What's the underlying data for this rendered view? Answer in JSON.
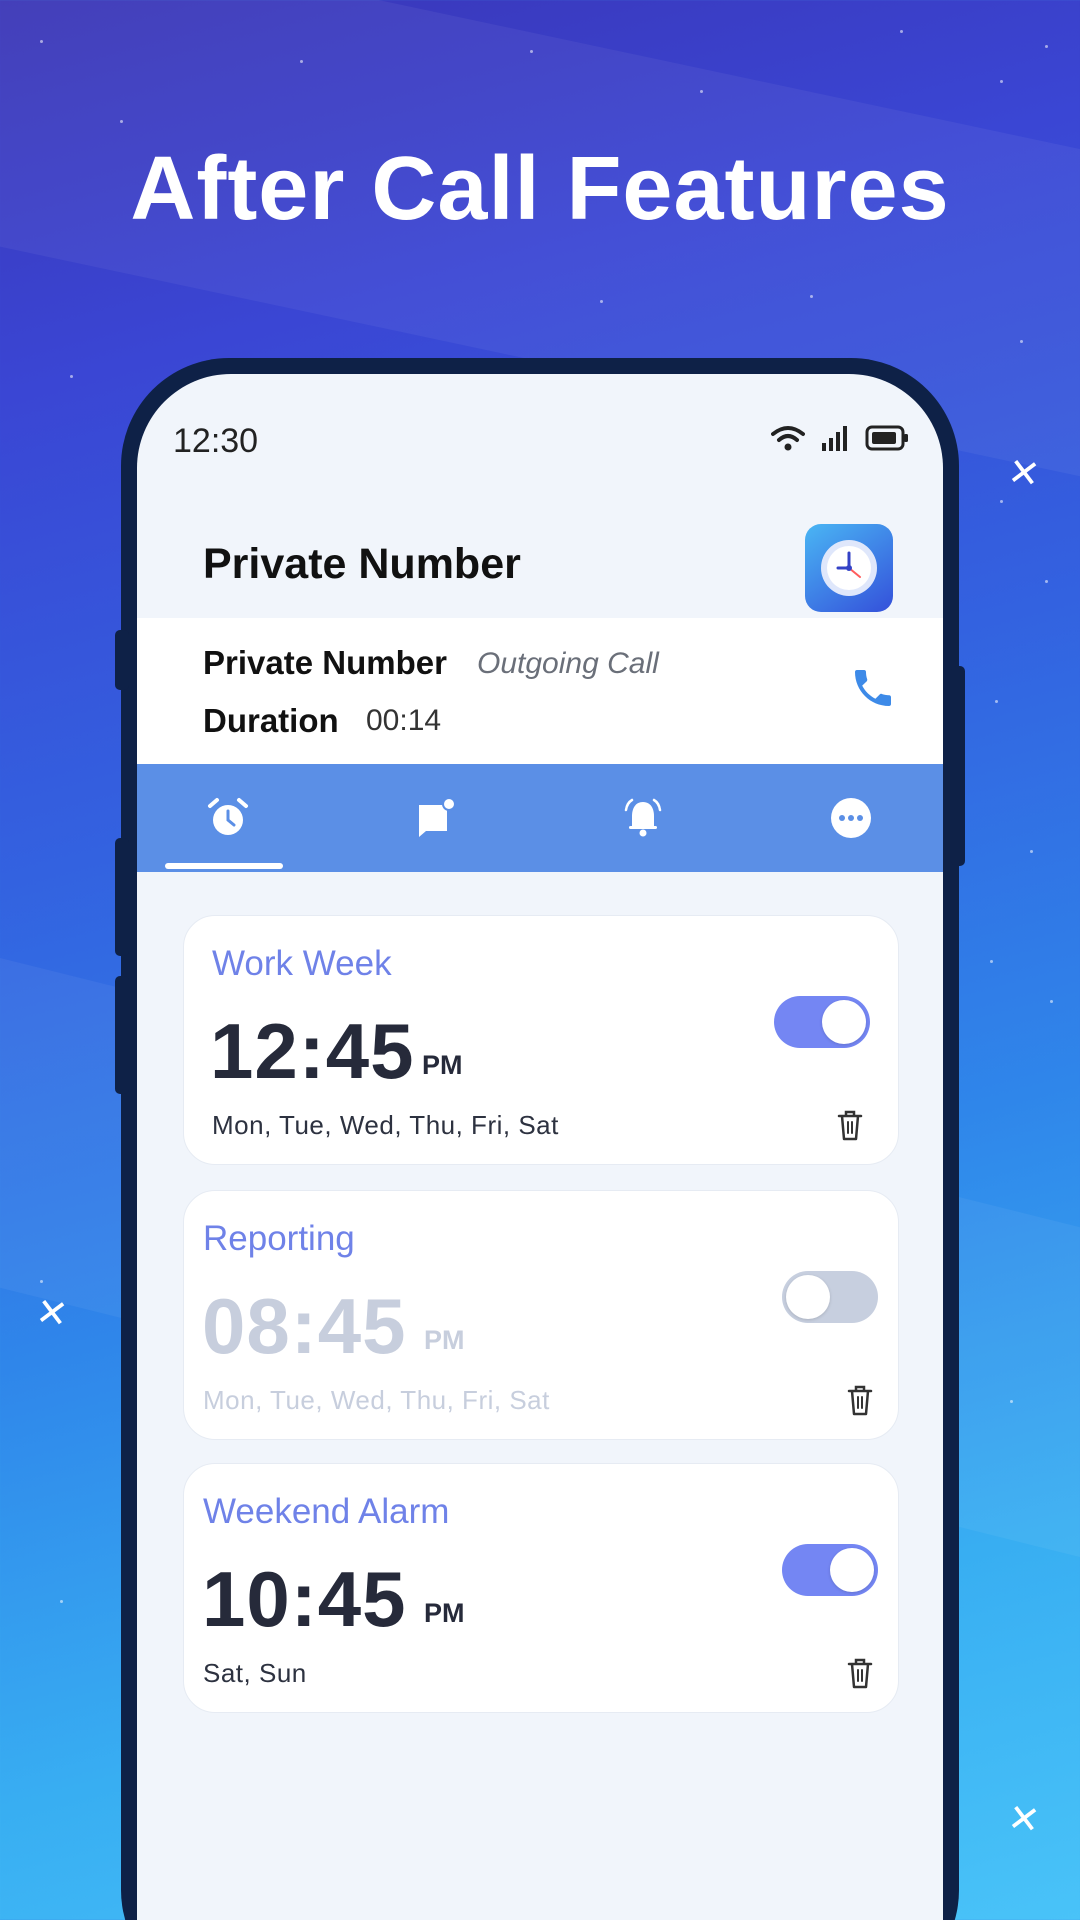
{
  "headline": "After Call Features",
  "status_bar": {
    "time": "12:30",
    "icons": [
      "wifi-icon",
      "signal-icon",
      "battery-icon"
    ]
  },
  "call_header": {
    "title": "Private Number",
    "app_icon": "clock-icon"
  },
  "call_info": {
    "name": "Private Number",
    "type": "Outgoing Call",
    "duration_label": "Duration",
    "duration": "00:14",
    "action_icon": "phone-icon"
  },
  "tabs": [
    {
      "icon": "alarm-clock-icon",
      "selected": true
    },
    {
      "icon": "message-icon",
      "selected": false
    },
    {
      "icon": "bell-icon",
      "selected": false
    },
    {
      "icon": "more-icon",
      "selected": false
    }
  ],
  "alarms": [
    {
      "label": "Work Week",
      "time": "12:45",
      "ampm": "PM",
      "days": "Mon, Tue, Wed, Thu, Fri, Sat",
      "enabled": true
    },
    {
      "label": "Reporting",
      "time": "08:45",
      "ampm": "PM",
      "days": "Mon, Tue, Wed, Thu, Fri, Sat",
      "enabled": false
    },
    {
      "label": "Weekend Alarm",
      "time": "10:45",
      "ampm": "PM",
      "days": "Sat, Sun",
      "enabled": true
    }
  ],
  "colors": {
    "accent": "#7486f3",
    "tabbar": "#5b8fe6",
    "phone_action": "#3d8ae8",
    "toggle_off": "#c7cfdf"
  }
}
